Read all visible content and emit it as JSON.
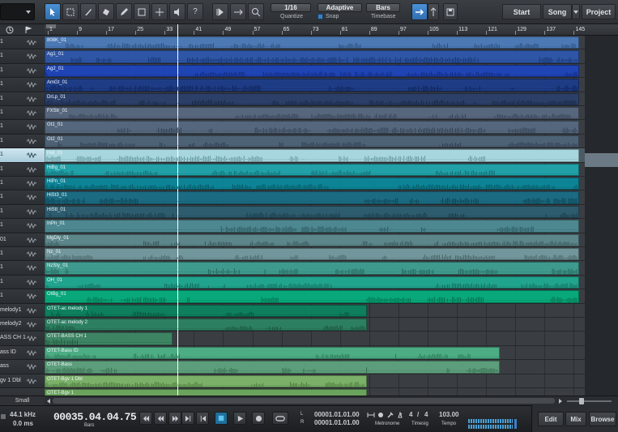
{
  "toolbar": {
    "quantize_value": "1/16",
    "quantize_label": "Quantize",
    "snap_value": "Adaptive",
    "snap_label": "Snap",
    "timebase_value": "Bars",
    "timebase_label": "Timebase",
    "help_label": "?",
    "nav": [
      "Start",
      "Song",
      "Project"
    ]
  },
  "ruler": {
    "marks": [
      "1",
      "9",
      "17",
      "25",
      "33",
      "41",
      "49",
      "57",
      "65",
      "73",
      "81",
      "89",
      "97",
      "105",
      "113",
      "121",
      "129",
      "137",
      "145"
    ]
  },
  "tracks": [
    {
      "name": "1",
      "event": "808K_01",
      "color": "#4c79b4",
      "start": 0,
      "end": 660,
      "wave": "#1e3f6b"
    },
    {
      "name": "1",
      "event": "Ag1_01",
      "color": "#2f56a6",
      "start": 0,
      "end": 660,
      "wave": "#0f2a60"
    },
    {
      "name": "1",
      "event": "Ag2_01",
      "color": "#1f44b4",
      "start": 0,
      "end": 660,
      "wave": "#0c226b"
    },
    {
      "name": "1",
      "event": "AmGt_01",
      "color": "#1e3c86",
      "start": 0,
      "end": 660,
      "wave": "#0a1c48"
    },
    {
      "name": "1",
      "event": "DrLp_01",
      "color": "#2b3f68",
      "start": 0,
      "end": 660,
      "wave": "#13203a"
    },
    {
      "name": "1",
      "event": "FXStr_01",
      "color": "#56667d",
      "start": 0,
      "end": 660,
      "wave": "#2c3645"
    },
    {
      "name": "1",
      "event": "Gt1_01",
      "color": "#55677d",
      "start": 0,
      "end": 660,
      "wave": "#2a3545"
    },
    {
      "name": "1",
      "event": "Gt2_01",
      "color": "#4e6276",
      "start": 0,
      "end": 660,
      "wave": "#263342"
    },
    {
      "name": "1",
      "event": "Hat_01",
      "color": "#a8d6de",
      "start": 0,
      "end": 660,
      "wave": "#4a7f88",
      "selected": true
    },
    {
      "name": "1",
      "event": "HiBg_01",
      "color": "#21a0a7",
      "start": 0,
      "end": 660,
      "wave": "#0d5c61"
    },
    {
      "name": "1",
      "event": "HiPn_01",
      "color": "#0d8496",
      "start": 0,
      "end": 660,
      "wave": "#044652"
    },
    {
      "name": "1",
      "event": "HiSt3_01",
      "color": "#1b6b82",
      "start": 0,
      "end": 660,
      "wave": "#0a3442"
    },
    {
      "name": "1",
      "event": "HiStt_01",
      "color": "#2d5c6e",
      "start": 0,
      "end": 660,
      "wave": "#13303a"
    },
    {
      "name": "1",
      "event": "InPn_01",
      "color": "#4d8790",
      "start": 0,
      "end": 660,
      "wave": "#23464c"
    },
    {
      "name": "01",
      "event": "MgDly_01",
      "color": "#5c868a",
      "start": 0,
      "end": 660,
      "wave": "#2b4548"
    },
    {
      "name": "1",
      "event": "Nz_01",
      "color": "#71969b",
      "start": 0,
      "end": 660,
      "wave": "#3a5255"
    },
    {
      "name": "1",
      "event": "NzSty_01",
      "color": "#3f9a8e",
      "start": 0,
      "end": 660,
      "wave": "#1c5249"
    },
    {
      "name": "1",
      "event": "OH_01",
      "color": "#21a48d",
      "start": 0,
      "end": 660,
      "wave": "#0d5c4d"
    },
    {
      "name": "1",
      "event": "OtBg_01",
      "color": "#08a87a",
      "start": 0,
      "end": 660,
      "wave": "#035c41"
    },
    {
      "name": "melody1",
      "event": "OTET-ac melody 1",
      "color": "#0d7f5d",
      "start": 0,
      "end": 398,
      "wave": "#05462f"
    },
    {
      "name": "melody2",
      "event": "OTET-ac melody 2",
      "color": "#2d7f62",
      "start": 0,
      "end": 398,
      "wave": "#124531"
    },
    {
      "name": "ASS CH 1",
      "event": "OTET-BASS CH 1",
      "color": "#3d8463",
      "start": 0,
      "end": 158,
      "wave": "#1a4a33"
    },
    {
      "name": "ass ID",
      "event": "OTET-Bass ID",
      "color": "#4cac84",
      "start": 0,
      "end": 562,
      "wave": "#1f6446"
    },
    {
      "name": "ass",
      "event": "OTET-Bass",
      "color": "#5c9e7b",
      "start": 0,
      "end": 562,
      "wave": "#2b5a42"
    },
    {
      "name": "gv 1 Dbl",
      "event": "OTET-Bgv 1 Dbl",
      "color": "#7ab068",
      "start": 0,
      "end": 398,
      "wave": "#3d6630"
    },
    {
      "name": "",
      "event": "OTET-Bgv 1",
      "color": "#6aa45c",
      "start": 0,
      "end": 398,
      "wave": "#355a2b"
    }
  ],
  "tracklist": {
    "size_label": "Small"
  },
  "transport": {
    "sample_rate": "44.1 kHz",
    "latency": "0.0 ms",
    "position": "00035.04.04.75",
    "position_unit": "Bars",
    "left_locator": "00001.01.01.00",
    "right_locator": "00001.01.01.00",
    "locator_l": "L",
    "locator_r": "R",
    "metronome_label": "Metronome",
    "timesig_num": "4",
    "timesig_sep": "/",
    "timesig_den": "4",
    "timesig_label": "Timesig",
    "tempo": "103.00",
    "tempo_label": "Tempo",
    "panes": [
      "Edit",
      "Mix",
      "Browse"
    ]
  },
  "colors": {
    "accent": "#3a7fc4",
    "playhead": "#ffffff"
  }
}
